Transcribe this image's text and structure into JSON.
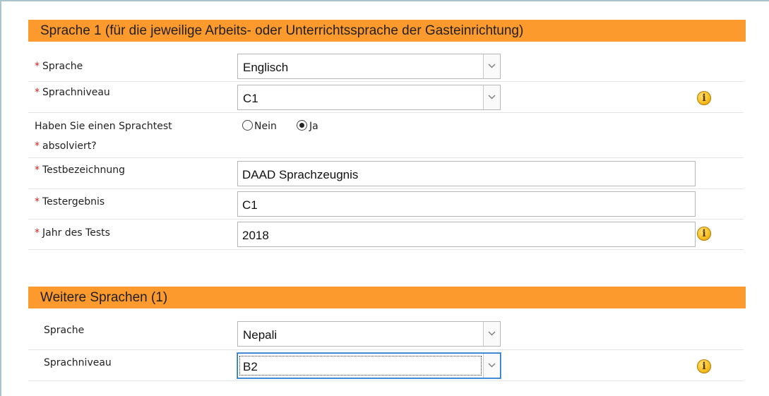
{
  "section1": {
    "title": "Sprache 1 (für die jeweilige Arbeits- oder Unterrichtssprache der Gasteinrichtung)",
    "required_marker": "*",
    "sprache": {
      "label": "Sprache",
      "value": "Englisch"
    },
    "sprachniveau": {
      "label": "Sprachniveau",
      "value": "C1"
    },
    "sprachtest": {
      "label_line1": "Haben Sie einen Sprachtest",
      "label_line2": "absolviert?",
      "option_no": "Nein",
      "option_yes": "Ja",
      "selected": "Ja"
    },
    "testbezeichnung": {
      "label": "Testbezeichnung",
      "value": "DAAD Sprachzeugnis"
    },
    "testergebnis": {
      "label": "Testergebnis",
      "value": "C1"
    },
    "jahr": {
      "label": "Jahr des Tests",
      "value": "2018"
    }
  },
  "section2": {
    "title": "Weitere Sprachen (1)",
    "sprache": {
      "label": "Sprache",
      "value": "Nepali"
    },
    "sprachniveau": {
      "label": "Sprachniveau",
      "value": "B2"
    }
  },
  "icons": {
    "info": "i",
    "chevron": "chevron-down-icon"
  },
  "colors": {
    "header_bg": "#fd9a2d",
    "required": "#e0201b",
    "focus": "#1a73c9"
  }
}
